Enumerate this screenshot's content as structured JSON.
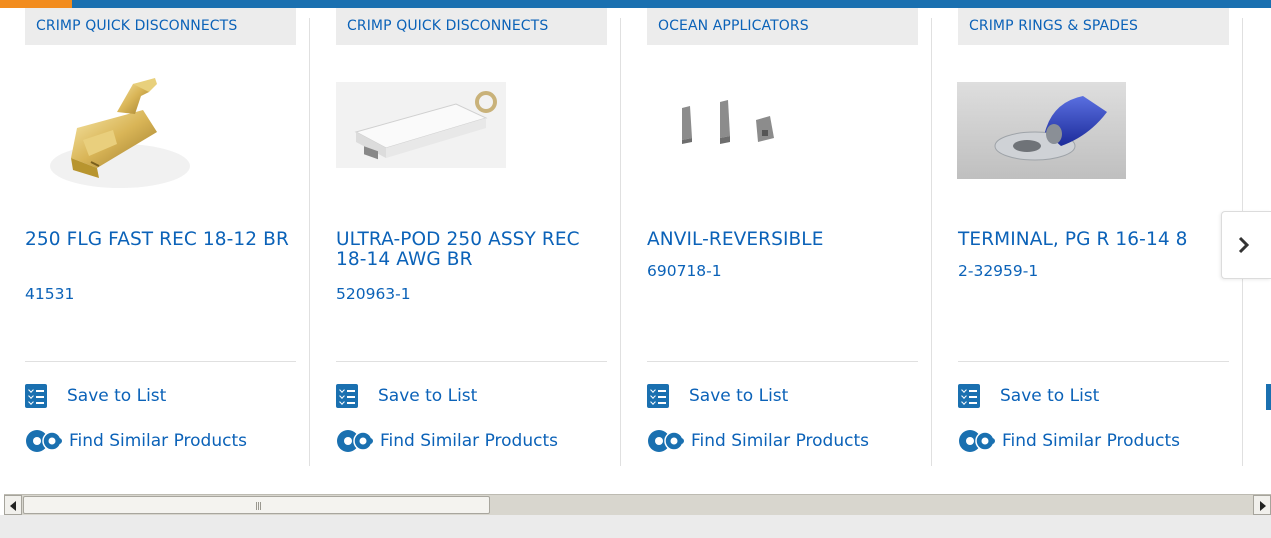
{
  "products": [
    {
      "category": "CRIMP QUICK DISCONNECTS",
      "title": "250 FLG FAST REC 18-12 BR",
      "part_number": "41531",
      "image": "flag-receptacle-brass",
      "save_label": "Save to List",
      "similar_label": "Find Similar Products"
    },
    {
      "category": "CRIMP QUICK DISCONNECTS",
      "title": "ULTRA-POD 250 ASSY REC 18-14 AWG BR",
      "part_number": "520963-1",
      "image": "insulated-receptacle-white",
      "save_label": "Save to List",
      "similar_label": "Find Similar Products"
    },
    {
      "category": "OCEAN APPLICATORS",
      "title": "ANVIL-REVERSIBLE",
      "part_number": "690718-1",
      "image": "anvil-parts",
      "save_label": "Save to List",
      "similar_label": "Find Similar Products"
    },
    {
      "category": "CRIMP RINGS & SPADES",
      "title": "TERMINAL, PG R 16-14 8",
      "part_number": "2-32959-1",
      "image": "ring-terminal-blue",
      "save_label": "Save to List",
      "similar_label": "Find Similar Products"
    }
  ],
  "carousel": {
    "next_icon": "chevron-right-icon"
  },
  "icons": {
    "save": "checklist-icon",
    "similar": "gears-icon"
  },
  "colors": {
    "accent": "#f28c1e",
    "brand": "#1a70b0",
    "link": "#0b62b8"
  }
}
